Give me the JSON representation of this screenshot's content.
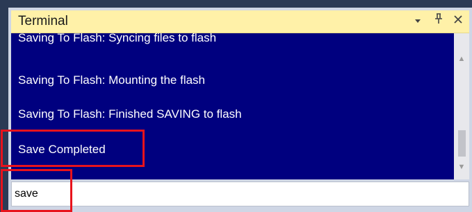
{
  "terminal": {
    "title": "Terminal",
    "dropdown_icon": "chevron-down-icon",
    "pin_icon": "pin-icon",
    "close_icon": "close-icon",
    "lines": [
      "Saving To Flash: Syncing files to flash",
      "Saving To Flash: Mounting the flash",
      "Saving To Flash: Finished SAVING to flash",
      "Save Completed"
    ],
    "input_value": "save"
  },
  "colors": {
    "output_background": "#00007f",
    "title_background": "#fff1a8",
    "highlight_border": "#e8131c"
  }
}
